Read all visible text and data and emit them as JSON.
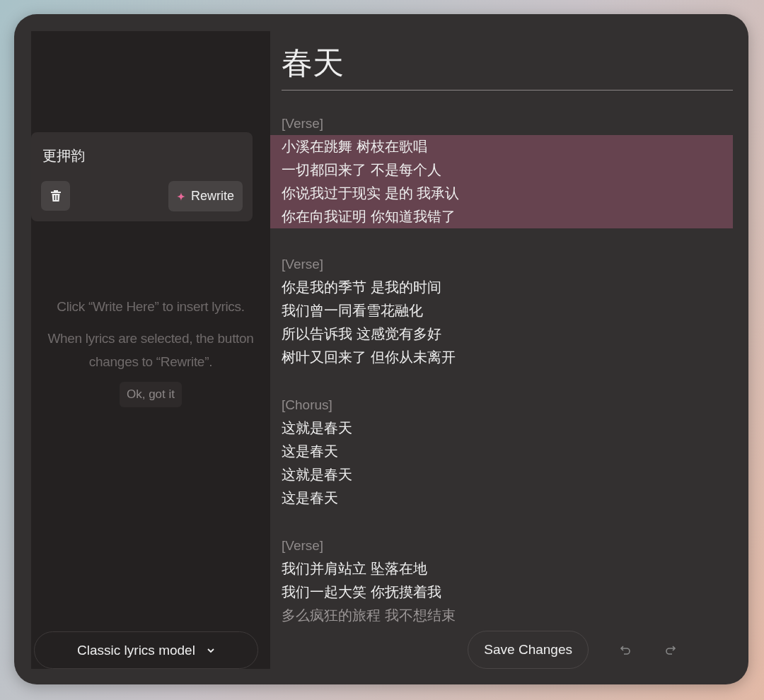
{
  "sidebar": {
    "prompt_card": {
      "prompt": "更押韵",
      "rewrite_button": "Rewrite"
    },
    "hints": [
      "Click “Write Here” to insert lyrics.",
      "When lyrics are selected, the button changes to “Rewrite”."
    ],
    "dismiss_button": "Ok, got it",
    "model_selector": "Classic lyrics model"
  },
  "editor": {
    "title": "春天",
    "sections": [
      {
        "label": "[Verse]",
        "lines": [
          {
            "text": "小溪在跳舞 树枝在歌唱",
            "selected": true
          },
          {
            "text": "一切都回来了 不是每个人",
            "selected": true
          },
          {
            "text": "你说我过于现实 是的 我承认",
            "selected": true
          },
          {
            "text": "你在向我证明 你知道我错了",
            "selected": true
          }
        ]
      },
      {
        "label": "[Verse]",
        "lines": [
          {
            "text": "你是我的季节 是我的时间",
            "selected": false
          },
          {
            "text": "我们曾一同看雪花融化",
            "selected": false
          },
          {
            "text": "所以告诉我 这感觉有多好",
            "selected": false
          },
          {
            "text": "树叶又回来了 但你从未离开",
            "selected": false
          }
        ]
      },
      {
        "label": "[Chorus]",
        "lines": [
          {
            "text": "这就是春天",
            "selected": false
          },
          {
            "text": "这是春天",
            "selected": false
          },
          {
            "text": "这就是春天",
            "selected": false
          },
          {
            "text": "这是春天",
            "selected": false
          }
        ]
      },
      {
        "label": "[Verse]",
        "lines": [
          {
            "text": "我们并肩站立 坠落在地",
            "selected": false
          },
          {
            "text": "我们一起大笑 你抚摸着我",
            "selected": false
          },
          {
            "text": "多么疯狂的旅程 我不想结束",
            "selected": false
          }
        ]
      }
    ],
    "save_button": "Save Changes"
  }
}
